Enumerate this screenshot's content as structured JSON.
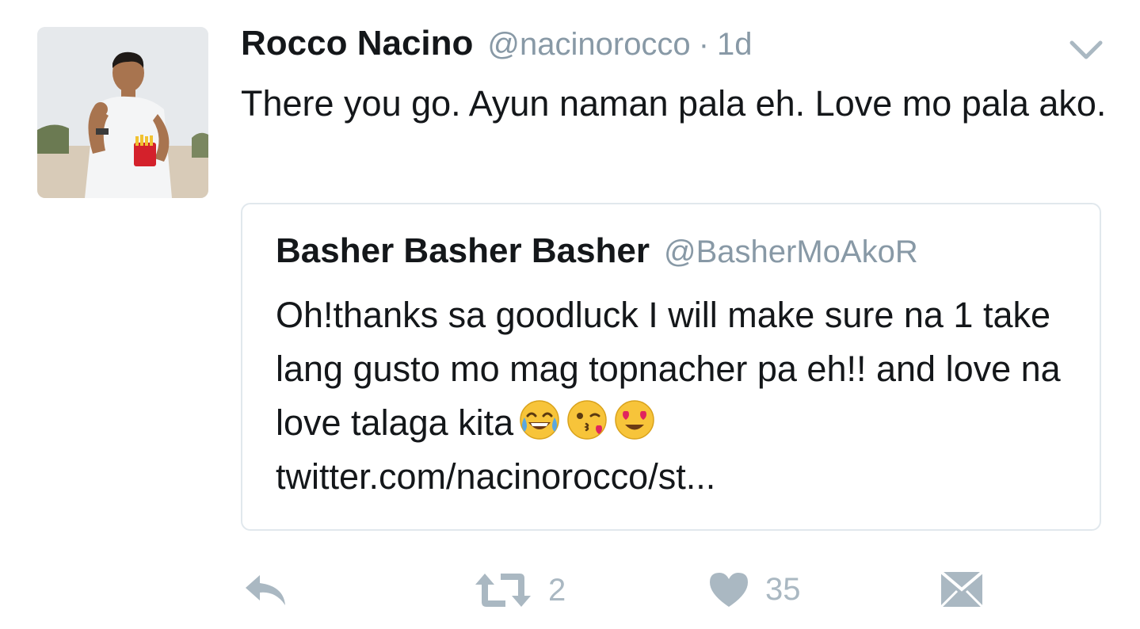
{
  "tweet": {
    "author_name": "Rocco Nacino",
    "author_handle": "@nacinorocco",
    "separator": "·",
    "time": "1d",
    "text": "There you go. Ayun naman pala eh. Love mo pala ako."
  },
  "quoted": {
    "author_name": "Basher Basher Basher",
    "author_handle": "@BasherMoAkoR",
    "text_line1": "Oh!thanks sa goodluck I will make sure na 1 take lang gusto mo mag topnacher pa eh!! and love na love talaga kita",
    "emojis": [
      "face-with-tears-of-joy",
      "face-blowing-kiss",
      "smiling-face-with-heart-eyes"
    ],
    "link": "twitter.com/nacinorocco/st..."
  },
  "actions": {
    "reply_icon": "reply-icon",
    "retweet_icon": "retweet-icon",
    "retweet_count": "2",
    "like_icon": "heart-icon",
    "like_count": "35",
    "dm_icon": "envelope-icon"
  },
  "colors": {
    "text": "#14171a",
    "muted": "#8899a6",
    "action": "#aab8c2",
    "border": "#e1e8ed"
  }
}
